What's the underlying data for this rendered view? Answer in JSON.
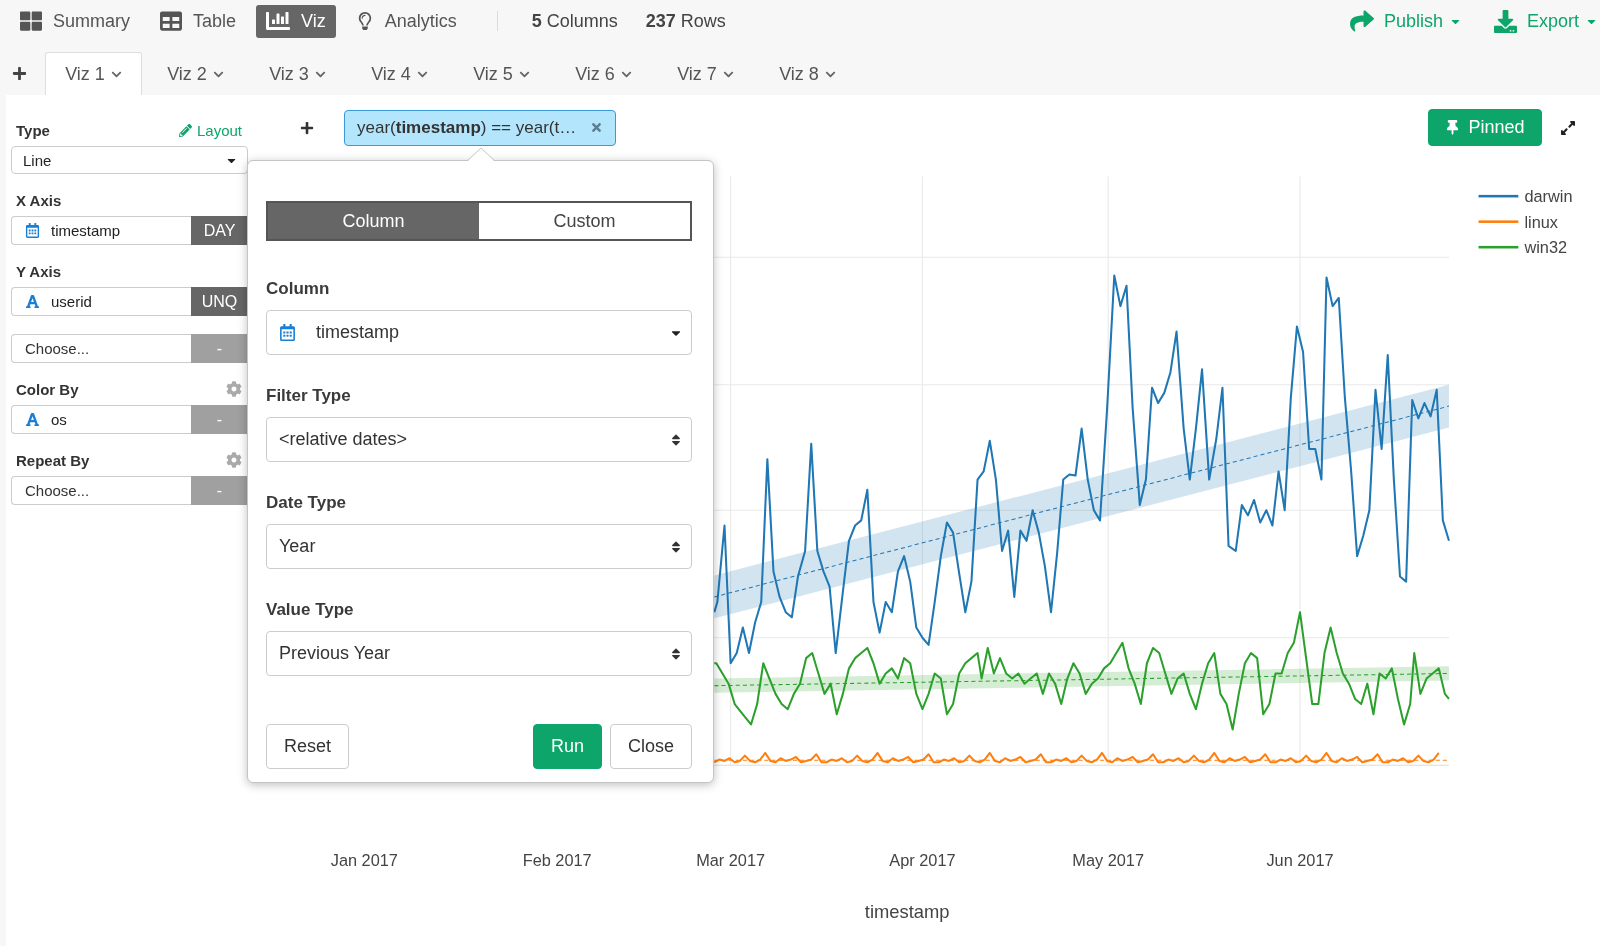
{
  "top_nav": {
    "views": [
      {
        "kind": "summary",
        "label": "Summary",
        "selected": false
      },
      {
        "kind": "table",
        "label": "Table",
        "selected": false
      },
      {
        "kind": "viz",
        "label": "Viz",
        "selected": true
      },
      {
        "kind": "analytics",
        "label": "Analytics",
        "selected": false
      }
    ],
    "stats": [
      "**5** Columns",
      "**237** Rows"
    ],
    "actions": [
      {
        "kind": "publish",
        "label": "Publish"
      },
      {
        "kind": "export",
        "label": "Export"
      }
    ]
  },
  "viz_tabs": [
    {
      "label": "Viz 1",
      "selected": true
    },
    {
      "label": "Viz 2",
      "selected": false
    },
    {
      "label": "Viz 3",
      "selected": false
    },
    {
      "label": "Viz 4",
      "selected": false
    },
    {
      "label": "Viz 5",
      "selected": false
    },
    {
      "label": "Viz 6",
      "selected": false
    },
    {
      "label": "Viz 7",
      "selected": false
    },
    {
      "label": "Viz 8",
      "selected": false
    }
  ],
  "sidebar": {
    "sections": [
      {
        "label": "Type",
        "link": "Layout",
        "settings": false,
        "fields": [
          {
            "kind": "select",
            "value": "Line"
          }
        ]
      },
      {
        "label": "X Axis",
        "settings": false,
        "fields": [
          {
            "kind": "date",
            "value": "timestamp",
            "tag": "DAY",
            "tag_active": true
          }
        ]
      },
      {
        "label": "Y Axis",
        "settings": false,
        "fields": [
          {
            "kind": "text",
            "value": "userid",
            "tag": "UNQ",
            "tag_active": true
          },
          {
            "kind": "empty",
            "placeholder": "Choose...",
            "tag": "-",
            "tag_active": false
          }
        ]
      },
      {
        "label": "Color By",
        "settings": true,
        "fields": [
          {
            "kind": "text",
            "value": "os",
            "tag": "-",
            "tag_active": false
          }
        ]
      },
      {
        "label": "Repeat By",
        "settings": true,
        "fields": [
          {
            "kind": "empty",
            "placeholder": "Choose...",
            "tag": "-",
            "tag_active": false
          }
        ]
      }
    ]
  },
  "filters": [
    {
      "expression": "year(**timestamp**) == year(t…"
    }
  ],
  "pinned_button": {
    "label": "Pinned",
    "on": true
  },
  "filter_popover": {
    "modes": [
      {
        "label": "Column",
        "selected": true
      },
      {
        "label": "Custom",
        "selected": false
      }
    ],
    "fields": [
      {
        "label": "Column",
        "kind": "date",
        "value": "timestamp"
      },
      {
        "label": "Filter Type",
        "kind": "spinner",
        "value": "<relative dates>"
      },
      {
        "label": "Date Type",
        "kind": "spinner",
        "value": "Year"
      },
      {
        "label": "Value Type",
        "kind": "spinner",
        "value": "Previous Year"
      }
    ],
    "buttons": [
      {
        "label": "Reset",
        "kind": "reset"
      },
      {
        "label": "Run",
        "kind": "primary"
      },
      {
        "label": "Close",
        "kind": "secondary"
      }
    ]
  },
  "chart": {
    "legend": [
      {
        "name": "darwin",
        "color": "#1f77b4"
      },
      {
        "name": "linux",
        "color": "#ff7f0e"
      },
      {
        "name": "win32",
        "color": "#2ca02c"
      }
    ],
    "xticks": [
      "Jan 2017",
      "Feb 2017",
      "Mar 2017",
      "Apr 2017",
      "May 2017",
      "Jun 2017"
    ],
    "xlabel": "timestamp"
  }
}
